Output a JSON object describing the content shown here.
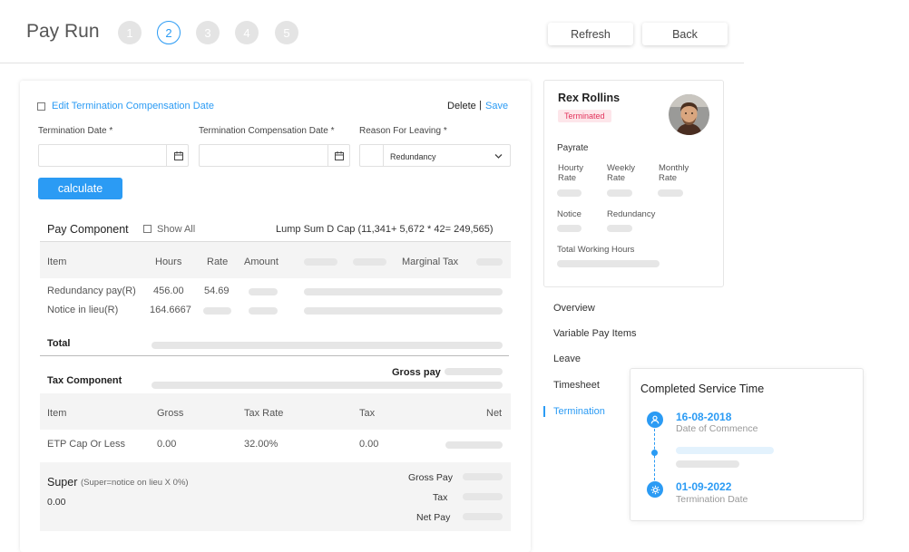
{
  "header": {
    "title": "Pay Run",
    "steps": [
      "1",
      "2",
      "3",
      "4",
      "5"
    ],
    "active_step": 2,
    "refresh_label": "Refresh",
    "back_label": "Back"
  },
  "termination": {
    "edit_checkbox_label": "Edit Termination Compensation Date",
    "delete_label": "Delete",
    "separator": "|",
    "save_label": "Save",
    "termination_date_label": "Termination Date *",
    "termination_date_value": "",
    "compensation_date_label": "Termination Compensation Date *",
    "compensation_date_value": "",
    "reason_label": "Reason For Leaving *",
    "reason_value": "Redundancy",
    "calculate_label": "calculate"
  },
  "pay_component": {
    "title": "Pay Component",
    "show_all_label": "Show All",
    "lump_sum_text": "Lump Sum D Cap (11,341+ 5,672 * 42= 249,565)",
    "columns": [
      "Item",
      "Hours",
      "Rate",
      "Amount",
      "Marginal Tax"
    ],
    "rows": [
      {
        "item": "Redundancy pay(R)",
        "hours": "456.00",
        "rate": "54.69"
      },
      {
        "item": "Notice in lieu(R)",
        "hours": "164.6667",
        "rate": ""
      }
    ],
    "total_label": "Total"
  },
  "tax_component": {
    "title": "Tax Component",
    "gross_pay_label": "Gross pay",
    "columns": [
      "Item",
      "Gross",
      "Tax Rate",
      "Tax",
      "Net"
    ],
    "rows": [
      {
        "item": "ETP Cap Or Less",
        "gross": "0.00",
        "tax_rate": "32.00%",
        "tax": "0.00"
      }
    ]
  },
  "super": {
    "title": "Super",
    "note": "(Super=notice on lieu X 0%)",
    "value": "0.00",
    "gross_pay_label": "Gross Pay",
    "tax_label": "Tax",
    "net_pay_label": "Net Pay"
  },
  "profile": {
    "name": "Rex Rollins",
    "status": "Terminated",
    "payrate_label": "Payrate",
    "hourly_rate_label": "Hourty Rate",
    "weekly_rate_label": "Weekly Rate",
    "monthly_rate_label": "Monthly Rate",
    "notice_label": "Notice",
    "redundancy_label": "Redundancy",
    "total_hours_label": "Total Working Hours"
  },
  "nav": {
    "items": [
      "Overview",
      "Variable Pay Items",
      "Leave",
      "Timesheet",
      "Termination"
    ],
    "active": "Termination"
  },
  "service": {
    "title": "Completed Service Time",
    "commence_date": "16-08-2018",
    "commence_label": "Date of Commence",
    "termination_date": "01-09-2022",
    "termination_label": "Termination Date"
  },
  "colors": {
    "accent": "#2b9bf4",
    "terminated_badge_bg": "#fde6ea",
    "terminated_badge_text": "#e2335c"
  }
}
